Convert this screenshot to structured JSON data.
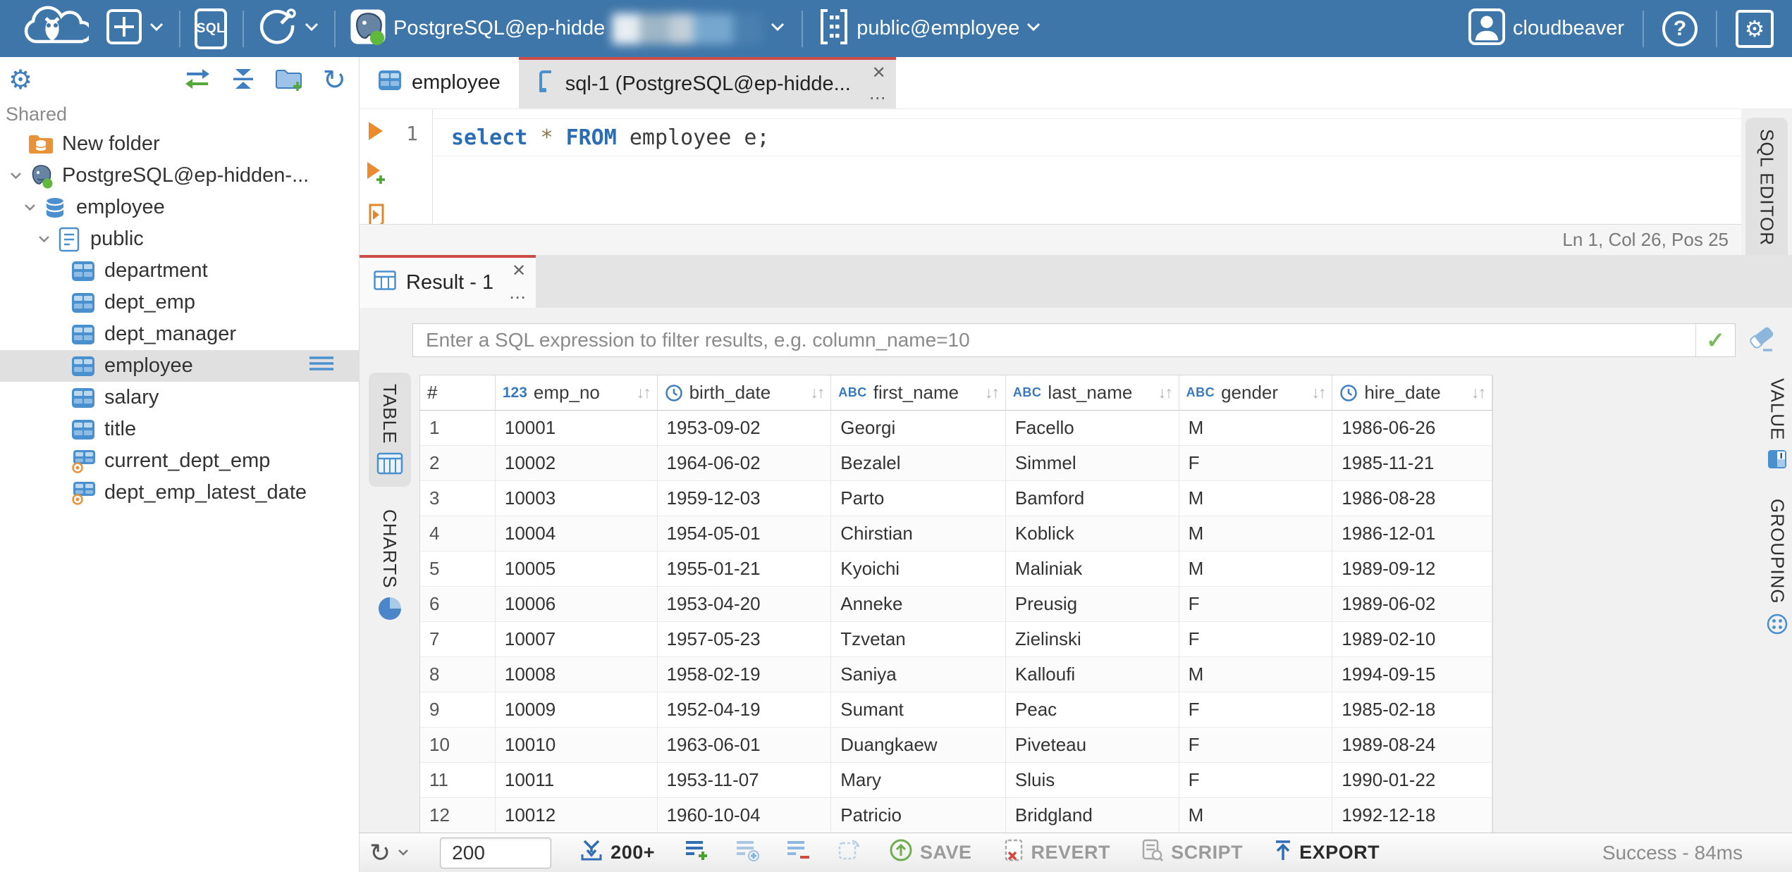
{
  "topbar": {
    "sql_button_label": "SQL",
    "connection_label": "PostgreSQL@ep-hidde",
    "schema_selector_label": "public@employee",
    "user_label": "cloudbeaver",
    "help_glyph": "?"
  },
  "sidebar": {
    "section_label": "Shared",
    "tree": [
      {
        "label": "New folder",
        "icon": "folder-db",
        "depth": 0,
        "chevron": false,
        "selected": false
      },
      {
        "label": "PostgreSQL@ep-hidden-...",
        "icon": "postgres",
        "depth": 0,
        "chevron": true,
        "selected": false
      },
      {
        "label": "employee",
        "icon": "database",
        "depth": 1,
        "chevron": true,
        "selected": false
      },
      {
        "label": "public",
        "icon": "schema",
        "depth": 2,
        "chevron": true,
        "selected": false
      },
      {
        "label": "department",
        "icon": "table",
        "depth": 3,
        "chevron": false,
        "selected": false
      },
      {
        "label": "dept_emp",
        "icon": "table",
        "depth": 3,
        "chevron": false,
        "selected": false
      },
      {
        "label": "dept_manager",
        "icon": "table",
        "depth": 3,
        "chevron": false,
        "selected": false
      },
      {
        "label": "employee",
        "icon": "table",
        "depth": 3,
        "chevron": false,
        "selected": true
      },
      {
        "label": "salary",
        "icon": "table",
        "depth": 3,
        "chevron": false,
        "selected": false
      },
      {
        "label": "title",
        "icon": "table",
        "depth": 3,
        "chevron": false,
        "selected": false
      },
      {
        "label": "current_dept_emp",
        "icon": "view",
        "depth": 3,
        "chevron": false,
        "selected": false
      },
      {
        "label": "dept_emp_latest_date",
        "icon": "view",
        "depth": 3,
        "chevron": false,
        "selected": false
      }
    ]
  },
  "editor": {
    "tabs": [
      {
        "label": "employee"
      },
      {
        "label": "sql-1 (PostgreSQL@ep-hidde..."
      }
    ],
    "line_number": "1",
    "sql": {
      "kw1": "select",
      "star": "*",
      "kw2": "FROM",
      "rest": "employee e;"
    },
    "status": "Ln 1, Col 26, Pos 25",
    "side_tab_label": "SQL EDITOR"
  },
  "result": {
    "tab_label": "Result - 1",
    "filter_placeholder": "Enter a SQL expression to filter results, e.g. column_name=10",
    "left_tabs": [
      {
        "label": "TABLE"
      },
      {
        "label": "CHARTS"
      }
    ],
    "right_tabs": [
      {
        "label": "VALUE"
      },
      {
        "label": "GROUPING"
      }
    ],
    "grid": {
      "columns": [
        {
          "label": "#",
          "type": "index"
        },
        {
          "label": "emp_no",
          "type": "number"
        },
        {
          "label": "birth_date",
          "type": "datetime"
        },
        {
          "label": "first_name",
          "type": "string"
        },
        {
          "label": "last_name",
          "type": "string"
        },
        {
          "label": "gender",
          "type": "string"
        },
        {
          "label": "hire_date",
          "type": "datetime"
        }
      ],
      "rows": [
        [
          "1",
          "10001",
          "1953-09-02",
          "Georgi",
          "Facello",
          "M",
          "1986-06-26"
        ],
        [
          "2",
          "10002",
          "1964-06-02",
          "Bezalel",
          "Simmel",
          "F",
          "1985-11-21"
        ],
        [
          "3",
          "10003",
          "1959-12-03",
          "Parto",
          "Bamford",
          "M",
          "1986-08-28"
        ],
        [
          "4",
          "10004",
          "1954-05-01",
          "Chirstian",
          "Koblick",
          "M",
          "1986-12-01"
        ],
        [
          "5",
          "10005",
          "1955-01-21",
          "Kyoichi",
          "Maliniak",
          "M",
          "1989-09-12"
        ],
        [
          "6",
          "10006",
          "1953-04-20",
          "Anneke",
          "Preusig",
          "F",
          "1989-06-02"
        ],
        [
          "7",
          "10007",
          "1957-05-23",
          "Tzvetan",
          "Zielinski",
          "F",
          "1989-02-10"
        ],
        [
          "8",
          "10008",
          "1958-02-19",
          "Saniya",
          "Kalloufi",
          "M",
          "1994-09-15"
        ],
        [
          "9",
          "10009",
          "1952-04-19",
          "Sumant",
          "Peac",
          "F",
          "1985-02-18"
        ],
        [
          "10",
          "10010",
          "1963-06-01",
          "Duangkaew",
          "Piveteau",
          "F",
          "1989-08-24"
        ],
        [
          "11",
          "10011",
          "1953-11-07",
          "Mary",
          "Sluis",
          "F",
          "1990-01-22"
        ],
        [
          "12",
          "10012",
          "1960-10-04",
          "Patricio",
          "Bridgland",
          "M",
          "1992-12-18"
        ]
      ]
    },
    "toolbar": {
      "row_limit_value": "200",
      "fetch_more_label": "200+",
      "save_label": "SAVE",
      "revert_label": "REVERT",
      "script_label": "SCRIPT",
      "export_label": "EXPORT",
      "status": "Success - 84ms"
    }
  },
  "icons": {
    "numeric_glyph": "123",
    "string_glyph": "ABC",
    "sort_glyph": "↓↑",
    "close_glyph": "✕",
    "more_glyph": "⋯",
    "refresh_glyph": "↻",
    "gear_glyph": "⚙",
    "check_glyph": "✓"
  },
  "colors": {
    "topbar_blue": "#3e76a9",
    "accent_blue": "#4a8fce",
    "tab_active_red": "#cc4b4b",
    "success_green": "#6fae4e",
    "selection_gray": "#e0e0e0"
  }
}
